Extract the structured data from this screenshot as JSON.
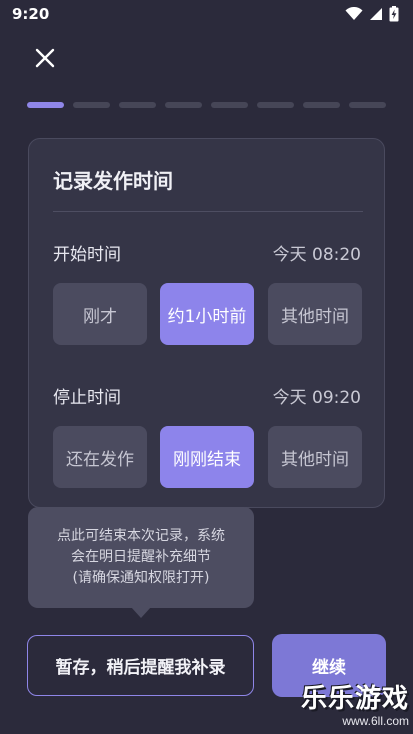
{
  "status_bar": {
    "time": "9:20"
  },
  "progress": {
    "total_steps": 8,
    "current_step": 1
  },
  "card": {
    "title": "记录发作时间",
    "start": {
      "label": "开始时间",
      "value": "今天 08:20",
      "options": [
        "刚才",
        "约1小时前",
        "其他时间"
      ],
      "selected_index": 1
    },
    "stop": {
      "label": "停止时间",
      "value": "今天 09:20",
      "options": [
        "还在发作",
        "刚刚结束",
        "其他时间"
      ],
      "selected_index": 1
    }
  },
  "tooltip": {
    "lines": [
      "点此可结束本次记录，系统",
      "会在明日提醒补充细节",
      "(请确保通知权限打开)"
    ]
  },
  "buttons": {
    "save_later": "暂存，稍后提醒我补录",
    "continue": "继续"
  },
  "watermark": {
    "title": "乐乐游戏",
    "url": "www.6ll.com"
  },
  "colors": {
    "background": "#2b2a3b",
    "card": "#353547",
    "accent": "#8d84eb",
    "option": "#4b4b5f"
  },
  "icons": {
    "close": "close-icon",
    "wifi": "wifi-icon",
    "signal": "cell-signal-icon",
    "battery": "battery-charging-icon"
  }
}
